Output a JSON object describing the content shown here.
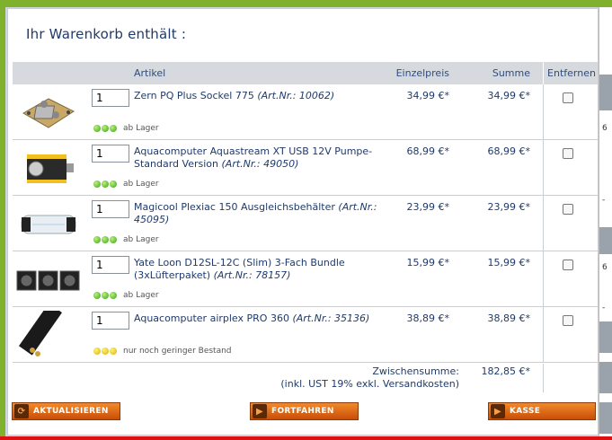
{
  "dialog": {
    "title": "Ihr Warenkorb enthält :"
  },
  "table": {
    "headers": {
      "article": "Artikel",
      "unit_price": "Einzelpreis",
      "sum": "Summe",
      "remove": "Entfernen"
    },
    "rows": [
      {
        "qty": "1",
        "name": "Zern PQ Plus Sockel 775 ",
        "art": "(Art.Nr.: 10062)",
        "availability": "ab Lager",
        "stock": "green",
        "unit_price": "34,99 €*",
        "sum": "34,99 €*",
        "image_icon": "cpu-waterblock-icon"
      },
      {
        "qty": "1",
        "name": "Aquacomputer Aquastream XT USB 12V Pumpe- Standard Version ",
        "art": "(Art.Nr.: 49050)",
        "availability": "ab Lager",
        "stock": "green",
        "unit_price": "68,99 €*",
        "sum": "68,99 €*",
        "image_icon": "pump-icon"
      },
      {
        "qty": "1",
        "name": "Magicool Plexiac 150 Ausgleichsbehälter ",
        "art": "(Art.Nr.: 45095)",
        "availability": "ab Lager",
        "stock": "green",
        "unit_price": "23,99 €*",
        "sum": "23,99 €*",
        "image_icon": "reservoir-icon"
      },
      {
        "qty": "1",
        "name": "Yate Loon D12SL-12C (Slim) 3-Fach Bundle (3xLüfterpaket) ",
        "art": "(Art.Nr.: 78157)",
        "availability": "ab Lager",
        "stock": "green",
        "unit_price": "15,99 €*",
        "sum": "15,99 €*",
        "image_icon": "fans-icon"
      },
      {
        "qty": "1",
        "name": "Aquacomputer airplex PRO 360 ",
        "art": "(Art.Nr.: 35136)",
        "availability": "nur noch geringer Bestand",
        "stock": "yellow",
        "unit_price": "38,89 €*",
        "sum": "38,89 €*",
        "image_icon": "radiator-icon"
      }
    ]
  },
  "totals": {
    "subtotal_label": "Zwischensumme:",
    "subtotal_value": "182,85 €*",
    "tax_note": "(inkl. UST 19% exkl. ",
    "shipping_link": "Versandkosten",
    "tax_note_end": ")"
  },
  "buttons": {
    "update": "AKTUALISIEREN",
    "continue": "FORTFAHREN",
    "checkout": "KASSE"
  },
  "colors": {
    "accent_orange": "#e06a12",
    "header_bg": "#d6d9dd",
    "text_blue": "#1f3a6b",
    "stock_green": "#3ea11a",
    "stock_yellow": "#d7b400"
  }
}
